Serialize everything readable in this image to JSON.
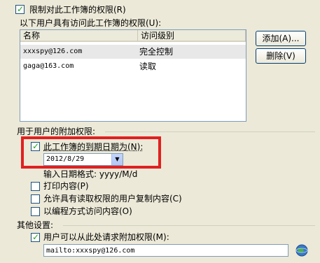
{
  "restrict_permission": {
    "label": "限制对此工作簿的权限(R)",
    "checked": true
  },
  "users_header": "以下用户具有访问此工作簿的权限(U):",
  "table": {
    "columns": [
      "名称",
      "访问级别"
    ],
    "rows": [
      {
        "name": "xxxspy@126.com",
        "level": "完全控制"
      },
      {
        "name": "gaga@163.com",
        "level": "读取"
      }
    ]
  },
  "buttons": {
    "add": "添加(A)...",
    "remove": "删除(V)"
  },
  "additional_header": "用于用户的附加权限:",
  "expiry": {
    "label": "此工作簿的到期日期为(N):",
    "checked": true,
    "date": "2012/8/29",
    "format_hint": "输入日期格式: yyyy/M/d"
  },
  "print": {
    "label": "打印内容(P)",
    "checked": false
  },
  "copy": {
    "label": "允许具有读取权限的用户复制内容(C)",
    "checked": false
  },
  "programmatic": {
    "label": "以编程方式访问内容(O)",
    "checked": false
  },
  "other_header": "其他设置:",
  "request_access": {
    "label": "用户可以从此处请求附加权限(M):",
    "checked": true,
    "value": "mailto:xxxspy@126.com"
  },
  "icons": {
    "globe": "globe-icon",
    "dropdown": "chevron-down-icon"
  },
  "colors": {
    "highlight": "#e02020"
  }
}
